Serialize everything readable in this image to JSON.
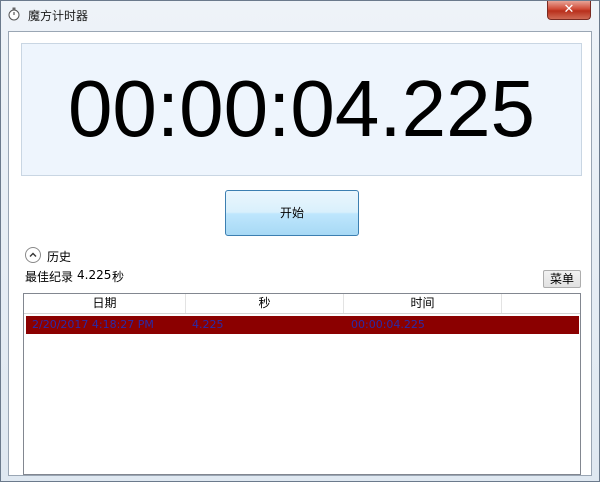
{
  "window": {
    "title": "魔方计时器",
    "close_label": "✕"
  },
  "timer": {
    "display": "00:00:04.225"
  },
  "controls": {
    "start_label": "开始",
    "menu_label": "菜单"
  },
  "history": {
    "label": "历史",
    "best_label": "最佳纪录",
    "best_value": "4.225",
    "best_unit": "秒"
  },
  "table": {
    "columns": [
      "日期",
      "秒",
      "时间"
    ],
    "rows": [
      {
        "date": "2/20/2017 4:18:27 PM",
        "seconds": "4.225",
        "time": "00:00:04.225"
      }
    ],
    "selected_row_color": "#8b0000"
  },
  "colors": {
    "close_button": "#cf4a36",
    "start_button": "#bee6fd",
    "timer_panel": "#eef5fd"
  }
}
